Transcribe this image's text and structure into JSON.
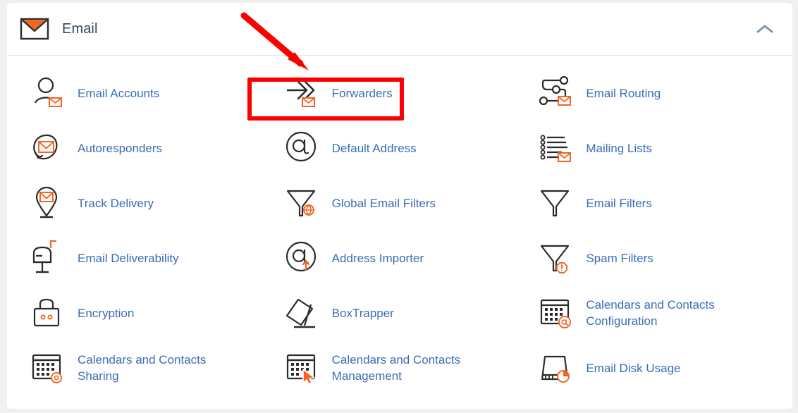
{
  "section": {
    "title": "Email",
    "icon": "envelope-icon",
    "collapse_icon": "chevron-up-icon",
    "expanded": true
  },
  "colors": {
    "link": "#3a6db5",
    "title": "#33475b",
    "accent_orange": "#f26522",
    "icon_dark": "#2b2b2b",
    "annotation_red": "#fb0000",
    "page_background": "#f0f0f2",
    "card_background": "#ffffff",
    "divider": "#dfe6f0"
  },
  "items": [
    {
      "label": "Email Accounts",
      "icon": "user-envelope-icon",
      "highlighted": false
    },
    {
      "label": "Forwarders",
      "icon": "forward-arrows-envelope-icon",
      "highlighted": true
    },
    {
      "label": "Email Routing",
      "icon": "routing-nodes-envelope-icon",
      "highlighted": false
    },
    {
      "label": "Autoresponders",
      "icon": "loop-arrow-envelope-icon",
      "highlighted": false
    },
    {
      "label": "Default Address",
      "icon": "at-circle-icon",
      "highlighted": false
    },
    {
      "label": "Mailing Lists",
      "icon": "list-envelope-icon",
      "highlighted": false
    },
    {
      "label": "Track Delivery",
      "icon": "map-pin-envelope-icon",
      "highlighted": false
    },
    {
      "label": "Global Email Filters",
      "icon": "funnel-globe-icon",
      "highlighted": false
    },
    {
      "label": "Email Filters",
      "icon": "funnel-icon",
      "highlighted": false
    },
    {
      "label": "Email Deliverability",
      "icon": "mailbox-flag-icon",
      "highlighted": false
    },
    {
      "label": "Address Importer",
      "icon": "at-upload-icon",
      "highlighted": false
    },
    {
      "label": "Spam Filters",
      "icon": "funnel-warning-icon",
      "highlighted": false
    },
    {
      "label": "Encryption",
      "icon": "padlock-icon",
      "highlighted": false
    },
    {
      "label": "BoxTrapper",
      "icon": "box-trap-icon",
      "highlighted": false
    },
    {
      "label": "Calendars and Contacts Configuration",
      "icon": "calendar-at-icon",
      "highlighted": false
    },
    {
      "label": "Calendars and Contacts Sharing",
      "icon": "calendar-gear-icon",
      "highlighted": false
    },
    {
      "label": "Calendars and Contacts Management",
      "icon": "calendar-cursor-icon",
      "highlighted": false
    },
    {
      "label": "Email Disk Usage",
      "icon": "disk-pie-icon",
      "highlighted": false
    }
  ],
  "annotations": {
    "highlight_box": {
      "target": "Forwarders",
      "shape": "rectangle",
      "color": "#fb0000"
    },
    "pointer_arrow": {
      "target": "Forwarders",
      "shape": "arrow",
      "color": "#fb0000",
      "direction": "down-right"
    }
  }
}
